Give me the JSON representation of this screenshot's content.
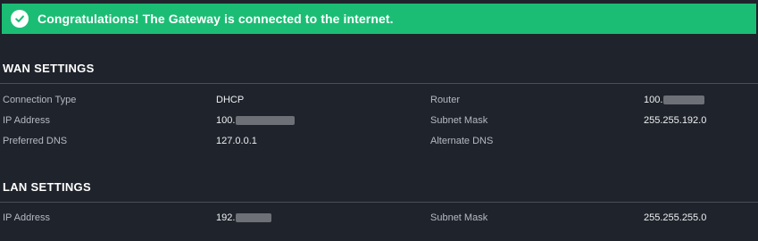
{
  "banner": {
    "message": "Congratulations! The Gateway is connected to the internet.",
    "icon": "check-circle-icon",
    "color": "#1bbd74"
  },
  "wan": {
    "title": "WAN SETTINGS",
    "connection_type_label": "Connection Type",
    "connection_type_value": "DHCP",
    "router_label": "Router",
    "router_value": "100.",
    "ip_label": "IP Address",
    "ip_value": "100.",
    "subnet_label": "Subnet Mask",
    "subnet_value": "255.255.192.0",
    "preferred_dns_label": "Preferred DNS",
    "preferred_dns_value": "127.0.0.1",
    "alternate_dns_label": "Alternate DNS",
    "alternate_dns_value": ""
  },
  "lan": {
    "title": "LAN SETTINGS",
    "ip_label": "IP Address",
    "ip_value": "192.",
    "subnet_label": "Subnet Mask",
    "subnet_value": "255.255.255.0"
  },
  "colors": {
    "background": "#1f232b",
    "label": "#b5bac3",
    "value": "#eef0f3",
    "divider": "#4a4f59"
  }
}
